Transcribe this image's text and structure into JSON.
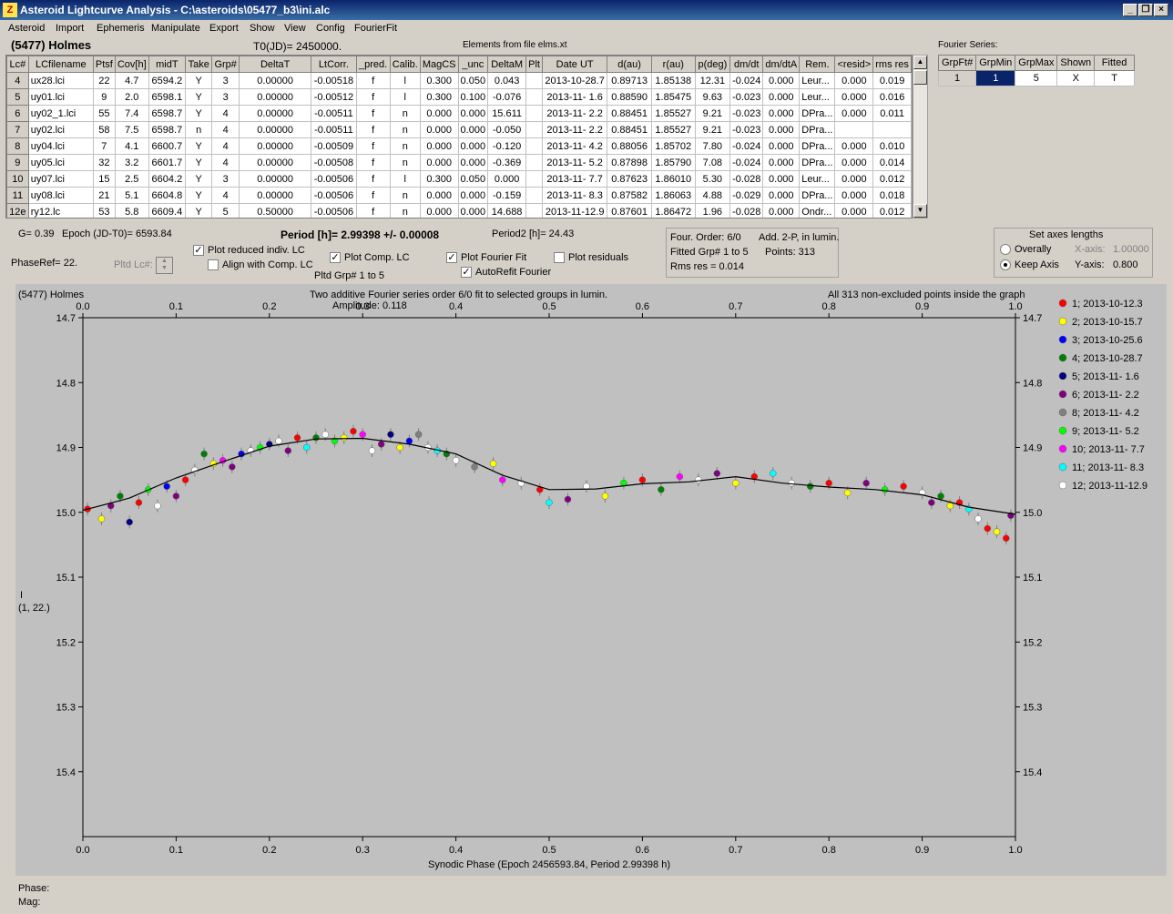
{
  "window": {
    "title": "Asteroid Lightcurve Analysis - C:\\asteroids\\05477_b3\\ini.alc",
    "app_icon": "lightcurve-app-icon"
  },
  "menu": [
    "Asteroid",
    "Import",
    "Ephemeris",
    "Manipulate",
    "Export",
    "Show",
    "View",
    "Config",
    "FourierFit"
  ],
  "header": {
    "asteroid": "(5477) Holmes",
    "t0": "T0(JD)= 2450000.",
    "elements": "Elements from file elms.xt"
  },
  "grid": {
    "columns": [
      "Lc#",
      "LCfilename",
      "Ptsf",
      "Cov[h]",
      "midT",
      "Take",
      "Grp#",
      "DeltaT",
      "LtCorr.",
      "_pred.",
      "Calib.",
      "MagCS",
      "_unc",
      "DeltaM",
      "Plt",
      "Date UT",
      "d(au)",
      "r(au)",
      "p(deg)",
      "dm/dt",
      "dm/dtA",
      "Rem.",
      "<resid>",
      "rms res"
    ],
    "rows": [
      [
        "4",
        "ux28.lci",
        "22",
        "4.7",
        "6594.2",
        "Y",
        "3",
        "0.00000",
        "-0.00518",
        "f",
        "l",
        "0.300",
        "0.050",
        "0.043",
        "",
        "2013-10-28.7",
        "0.89713",
        "1.85138",
        "12.31",
        "-0.024",
        "0.000",
        "Leur...",
        "0.000",
        "0.019"
      ],
      [
        "5",
        "uy01.lci",
        "9",
        "2.0",
        "6598.1",
        "Y",
        "3",
        "0.00000",
        "-0.00512",
        "f",
        "l",
        "0.300",
        "0.100",
        "-0.076",
        "",
        "2013-11- 1.6",
        "0.88590",
        "1.85475",
        "9.63",
        "-0.023",
        "0.000",
        "Leur...",
        "0.000",
        "0.016"
      ],
      [
        "6",
        "uy02_1.lci",
        "55",
        "7.4",
        "6598.7",
        "Y",
        "4",
        "0.00000",
        "-0.00511",
        "f",
        "n",
        "0.000",
        "0.000",
        "15.611",
        "",
        "2013-11- 2.2",
        "0.88451",
        "1.85527",
        "9.21",
        "-0.023",
        "0.000",
        "DPra...",
        "0.000",
        "0.011"
      ],
      [
        "7",
        "uy02.lci",
        "58",
        "7.5",
        "6598.7",
        "n",
        "4",
        "0.00000",
        "-0.00511",
        "f",
        "n",
        "0.000",
        "0.000",
        "-0.050",
        "",
        "2013-11- 2.2",
        "0.88451",
        "1.85527",
        "9.21",
        "-0.023",
        "0.000",
        "DPra...",
        "",
        ""
      ],
      [
        "8",
        "uy04.lci",
        "7",
        "4.1",
        "6600.7",
        "Y",
        "4",
        "0.00000",
        "-0.00509",
        "f",
        "n",
        "0.000",
        "0.000",
        "-0.120",
        "",
        "2013-11- 4.2",
        "0.88056",
        "1.85702",
        "7.80",
        "-0.024",
        "0.000",
        "DPra...",
        "0.000",
        "0.010"
      ],
      [
        "9",
        "uy05.lci",
        "32",
        "3.2",
        "6601.7",
        "Y",
        "4",
        "0.00000",
        "-0.00508",
        "f",
        "n",
        "0.000",
        "0.000",
        "-0.369",
        "",
        "2013-11- 5.2",
        "0.87898",
        "1.85790",
        "7.08",
        "-0.024",
        "0.000",
        "DPra...",
        "0.000",
        "0.014"
      ],
      [
        "10",
        "uy07.lci",
        "15",
        "2.5",
        "6604.2",
        "Y",
        "3",
        "0.00000",
        "-0.00506",
        "f",
        "l",
        "0.300",
        "0.050",
        "0.000",
        "",
        "2013-11- 7.7",
        "0.87623",
        "1.86010",
        "5.30",
        "-0.028",
        "0.000",
        "Leur...",
        "0.000",
        "0.012"
      ],
      [
        "11",
        "uy08.lci",
        "21",
        "5.1",
        "6604.8",
        "Y",
        "4",
        "0.00000",
        "-0.00506",
        "f",
        "n",
        "0.000",
        "0.000",
        "-0.159",
        "",
        "2013-11- 8.3",
        "0.87582",
        "1.86063",
        "4.88",
        "-0.029",
        "0.000",
        "DPra...",
        "0.000",
        "0.018"
      ],
      [
        "12e",
        "ry12.lc",
        "53",
        "5.8",
        "6609.4",
        "Y",
        "5",
        "0.50000",
        "-0.00506",
        "f",
        "n",
        "0.000",
        "0.000",
        "14.688",
        "",
        "2013-11-12.9",
        "0.87601",
        "1.86472",
        "1.96",
        "-0.028",
        "0.000",
        "Ondr...",
        "0.000",
        "0.012"
      ]
    ]
  },
  "fourier_series": {
    "label": "Fourier Series:",
    "columns": [
      "GrpFt#",
      "GrpMin",
      "GrpMax",
      "Shown",
      "Fitted"
    ],
    "row": [
      "1",
      "1",
      "5",
      "X",
      "T"
    ]
  },
  "params": {
    "g": "G= 0.39",
    "epoch": "Epoch (JD-T0)= 6593.84",
    "period": "Period [h]= 2.99398 +/- 0.00008",
    "period2": "Period2 [h]= 24.43",
    "phase_ref": "PhaseRef= 22.",
    "pltd_lc": "Pltd Lc#:",
    "plot_reduced": "Plot reduced indiv. LC",
    "align_comp": "Align with Comp. LC",
    "plot_comp": "Plot Comp. LC",
    "pltd_grp": "Pltd Grp#  1   to   5",
    "plot_fourier": "Plot Fourier Fit",
    "autorefit": "AutoRefit Fourier",
    "plot_residuals": "Plot residuals"
  },
  "fit_info": {
    "order": "Four. Order:  6/0",
    "add": "Add. 2-P, in lumin.",
    "fitted": "Fitted Grp# 1 to 5",
    "points": "Points: 313",
    "rms": "Rms res     = 0.014"
  },
  "axes_lengths": {
    "title": "Set axes lengths",
    "overally": "Overally",
    "keep_axis": "Keep Axis",
    "x_label": "X-axis:",
    "x_value": "1.00000",
    "y_label": "Y-axis:",
    "y_value": "0.800"
  },
  "plot_header": {
    "left": "(5477) Holmes",
    "center": "Two additive Fourier series order 6/0 fit to selected groups in lumin.",
    "amplitude": "Amplitude: 0.118",
    "right": "All 313 non-excluded points inside the graph",
    "ylabel_line1": "I",
    "ylabel_line2": "(1, 22.)"
  },
  "chart_data": {
    "type": "scatter",
    "xlabel": "Synodic Phase (Epoch 2456593.84, Period 2.99398 h)",
    "ylabel": "I",
    "xlim": [
      0.0,
      1.0
    ],
    "ylim": [
      14.7,
      15.5
    ],
    "y_inverted": true,
    "x_ticks": [
      "0.0",
      "0.1",
      "0.2",
      "0.3",
      "0.4",
      "0.5",
      "0.6",
      "0.7",
      "0.8",
      "0.9",
      "1.0"
    ],
    "y_ticks": [
      "14.7",
      "14.8",
      "14.9",
      "15.0",
      "15.1",
      "15.2",
      "15.3",
      "15.4"
    ],
    "legend_position": "right",
    "legend": [
      {
        "name": "1; 2013-10-12.3",
        "color": "#ff0000"
      },
      {
        "name": "2; 2013-10-15.7",
        "color": "#ffff00"
      },
      {
        "name": "3; 2013-10-25.6",
        "color": "#0000ff"
      },
      {
        "name": "4; 2013-10-28.7",
        "color": "#008000"
      },
      {
        "name": "5; 2013-11- 1.6",
        "color": "#000080"
      },
      {
        "name": "6; 2013-11- 2.2",
        "color": "#800080"
      },
      {
        "name": "8; 2013-11- 4.2",
        "color": "#808080"
      },
      {
        "name": "9; 2013-11- 5.2",
        "color": "#00ff00"
      },
      {
        "name": "10; 2013-11- 7.7",
        "color": "#ff00ff"
      },
      {
        "name": "11; 2013-11- 8.3",
        "color": "#00ffff"
      },
      {
        "name": "12; 2013-11-12.9",
        "color": "#ffffff"
      }
    ],
    "fourier_fit": {
      "x": [
        0.0,
        0.05,
        0.1,
        0.15,
        0.2,
        0.25,
        0.3,
        0.35,
        0.4,
        0.45,
        0.5,
        0.55,
        0.6,
        0.65,
        0.7,
        0.75,
        0.8,
        0.85,
        0.9,
        0.95,
        1.0
      ],
      "y": [
        14.997,
        14.978,
        14.947,
        14.922,
        14.898,
        14.887,
        14.886,
        14.895,
        14.91,
        14.943,
        14.965,
        14.964,
        14.956,
        14.953,
        14.945,
        14.955,
        14.961,
        14.965,
        14.973,
        14.992,
        15.003
      ]
    },
    "points": [
      [
        0.005,
        14.995,
        0
      ],
      [
        0.02,
        15.01,
        1
      ],
      [
        0.03,
        14.99,
        5
      ],
      [
        0.04,
        14.975,
        3
      ],
      [
        0.05,
        15.015,
        4
      ],
      [
        0.06,
        14.985,
        0
      ],
      [
        0.07,
        14.965,
        7
      ],
      [
        0.08,
        14.99,
        10
      ],
      [
        0.09,
        14.96,
        2
      ],
      [
        0.1,
        14.975,
        5
      ],
      [
        0.11,
        14.95,
        0
      ],
      [
        0.12,
        14.935,
        10
      ],
      [
        0.13,
        14.91,
        3
      ],
      [
        0.14,
        14.925,
        1
      ],
      [
        0.15,
        14.92,
        8
      ],
      [
        0.16,
        14.93,
        5
      ],
      [
        0.17,
        14.91,
        2
      ],
      [
        0.18,
        14.905,
        10
      ],
      [
        0.19,
        14.9,
        7
      ],
      [
        0.2,
        14.895,
        4
      ],
      [
        0.21,
        14.89,
        10
      ],
      [
        0.22,
        14.905,
        5
      ],
      [
        0.23,
        14.885,
        0
      ],
      [
        0.24,
        14.9,
        9
      ],
      [
        0.25,
        14.885,
        3
      ],
      [
        0.26,
        14.88,
        10
      ],
      [
        0.27,
        14.89,
        7
      ],
      [
        0.28,
        14.885,
        1
      ],
      [
        0.29,
        14.875,
        0
      ],
      [
        0.3,
        14.88,
        8
      ],
      [
        0.31,
        14.905,
        10
      ],
      [
        0.32,
        14.895,
        5
      ],
      [
        0.33,
        14.88,
        4
      ],
      [
        0.34,
        14.9,
        1
      ],
      [
        0.35,
        14.89,
        2
      ],
      [
        0.36,
        14.88,
        6
      ],
      [
        0.37,
        14.9,
        10
      ],
      [
        0.38,
        14.905,
        9
      ],
      [
        0.39,
        14.91,
        3
      ],
      [
        0.4,
        14.92,
        10
      ],
      [
        0.42,
        14.93,
        6
      ],
      [
        0.44,
        14.925,
        1
      ],
      [
        0.45,
        14.95,
        8
      ],
      [
        0.47,
        14.955,
        10
      ],
      [
        0.49,
        14.965,
        0
      ],
      [
        0.5,
        14.985,
        9
      ],
      [
        0.52,
        14.98,
        5
      ],
      [
        0.54,
        14.96,
        10
      ],
      [
        0.56,
        14.975,
        1
      ],
      [
        0.58,
        14.955,
        7
      ],
      [
        0.6,
        14.95,
        0
      ],
      [
        0.62,
        14.965,
        3
      ],
      [
        0.64,
        14.945,
        8
      ],
      [
        0.66,
        14.95,
        10
      ],
      [
        0.68,
        14.94,
        5
      ],
      [
        0.7,
        14.955,
        1
      ],
      [
        0.72,
        14.945,
        0
      ],
      [
        0.74,
        14.94,
        9
      ],
      [
        0.76,
        14.955,
        10
      ],
      [
        0.78,
        14.96,
        3
      ],
      [
        0.8,
        14.955,
        0
      ],
      [
        0.82,
        14.97,
        1
      ],
      [
        0.84,
        14.955,
        5
      ],
      [
        0.86,
        14.965,
        7
      ],
      [
        0.88,
        14.96,
        0
      ],
      [
        0.9,
        14.97,
        10
      ],
      [
        0.91,
        14.985,
        5
      ],
      [
        0.92,
        14.975,
        3
      ],
      [
        0.93,
        14.99,
        1
      ],
      [
        0.94,
        14.985,
        0
      ],
      [
        0.95,
        14.995,
        9
      ],
      [
        0.96,
        15.01,
        10
      ],
      [
        0.97,
        15.025,
        0
      ],
      [
        0.98,
        15.03,
        1
      ],
      [
        0.99,
        15.04,
        0
      ],
      [
        0.995,
        15.005,
        5
      ]
    ]
  },
  "status": {
    "phase": "Phase:",
    "mag": "Mag:"
  }
}
